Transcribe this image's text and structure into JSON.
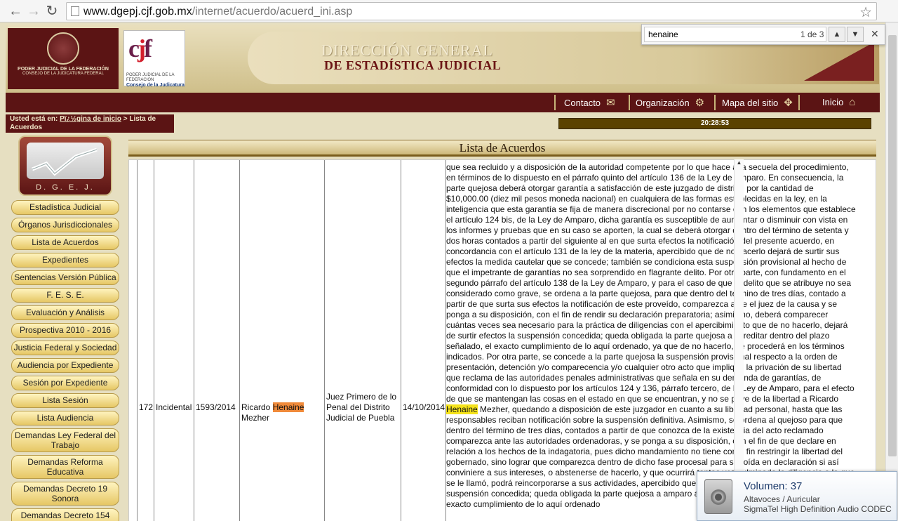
{
  "browser": {
    "url_host": "www.dgepj.cjf.gob.mx",
    "url_path": "/internet/acuerdo/acuerd_ini.asp",
    "icons": {
      "back": "back-arrow-icon",
      "forward": "forward-arrow-icon",
      "reload": "reload-icon",
      "star": "star-icon"
    }
  },
  "find": {
    "query": "henaine",
    "count": "1 de 3"
  },
  "header": {
    "seal_line1": "PODER JUDICIAL DE LA FEDERACIÓN",
    "seal_line2": "CONSEJO DE LA JUDICATURA FEDERAL",
    "cjf_sub1": "PODER JUDICIAL DE LA FEDERACIÓN",
    "cjf_sub2": "Consejo de la Judicatura",
    "title1": "DIRECCIÓN GENERAL",
    "title2": "DE ESTADÍSTICA JUDICIAL"
  },
  "nav": {
    "contacto": "Contacto",
    "organizacion": "Organización",
    "mapa": "Mapa del sitio",
    "inicio": "Inicio"
  },
  "breadcrumb": {
    "prefix": "Usted está en: ",
    "link": "Pï¿½gina de inicio",
    "suffix": " > Lista de Acuerdos"
  },
  "clock": "20:28:53",
  "sidebar": {
    "logo_label": "D. G. E. J.",
    "items": [
      "Estadística Judicial",
      "Órganos Jurisdiccionales",
      "Lista de Acuerdos",
      "Expedientes",
      "Sentencias Versión Pública",
      "F. E. S. E.",
      "Evaluación y Análisis",
      "Prospectiva 2010 - 2016",
      "Justicia Federal y Sociedad",
      "Audiencia por Expediente",
      "Sesión por Expediente",
      "Lista Sesión",
      "Lista Audiencia",
      "Demandas Ley Federal del Trabajo",
      "Demandas Reforma Educativa",
      "Demandas Decreto 19 Sonora",
      "Demandas Decreto 154"
    ]
  },
  "main": {
    "title": "Lista de Acuerdos",
    "row": {
      "num": "172",
      "tipo": "Incidental",
      "expediente": "1593/2014",
      "nombre_pre": "Ricardo ",
      "nombre_hl": "Henaine",
      "nombre_post": "Mezher",
      "juzgado": "Juez Primero de lo Penal del Distrito Judicial de Puebla",
      "fecha": "14/10/2014",
      "texto_a": "que sea recluido y a disposición de la autoridad competente por lo que hace a la secuela del procedimiento, en términos de lo dispuesto en el párrafo quinto del artículo 136 de la Ley de Amparo. En consecuencia, la parte quejosa deberá otorgar garantía a satisfacción de este juzgado de distrito, por la cantidad de $10,000.00 (diez mil pesos moneda nacional) en cualquiera de las formas establecidas en la ley, en la inteligencia que esta garantía se fija de manera discrecional por no contarse con los elementos que establece el artículo 124 bis, de la Ley de Amparo, dicha garantía es susceptible de aumentar o disminuir con vista en los informes y pruebas que en su caso se aporten, la cual se deberá otorgar dentro del término de setenta y dos horas contados a partir del siguiente al en que surta efectos la notificación del presente acuerdo, en concordancia con el artículo 131 de la ley de la materia, apercibido que de no hacerlo dejará de surtir sus efectos la medida cautelar que se concede; también se condiciona esta suspensión provisional al hecho de que el impetrante de garantías no sea sorprendido en flagrante delito. Por otra parte, con fundamento en el segundo párrafo del artículo 138 de la Ley de Amparo, y para el caso de que el delito que se atribuye no sea considerado como grave, se ordena a la parte quejosa, para que dentro del término de tres días, contado a partir de que surta sus efectos la notificación de este proveído, comparezca ante el juez de la causa y se ponga a su disposición, con el fin de rendir su declaración preparatoria; asimismo, deberá comparecer cuántas veces sea necesario para la práctica de diligencias con el apercibimiento que de no hacerlo, dejará de surtir efectos la suspensión concedida; queda obligada la parte quejosa a acreditar dentro del plazo señalado, el exacto cumplimiento de lo aquí ordenado, ya que de no hacerlo, se procederá en los términos indicados. Por otra parte, se concede a la parte quejosa la suspensión provisional respecto a la orden de presentación, detención y/o comparecencia y/o cualquier otro acto que implique la privación de su libertad que reclama de las autoridades penales administrativas que señala en su demanda de garantías, de conformidad con lo dispuesto por los artículos 124 y 136, párrafo tercero, de la Ley de Amparo, para el efecto de que se mantengan las cosas en el estado en que se encuentran, y no se prive de la libertad a Ricardo ",
      "texto_hl": "Henaine",
      "texto_b": " Mezher, quedando a disposición de este juzgador en cuanto a su libertad personal, hasta que las responsables reciban notificación sobre la suspensión definitiva. Asimismo, se ordena al quejoso para que dentro del término de tres días, contados a partir de que conozca de la existencia del acto reclamado comparezca ante las autoridades ordenadoras, y se ponga a su disposición, con el fin de que declare en relación a los hechos de la indagatoria, pues dicho mandamiento no tiene como fin restringir la libertad del gobernado, sino lograr que comparezca dentro de dicho fase procesal para ser oída en declaración si así conviniere a sus intereses, o abstenerse de hacerlo, y que ocurrirá tantas vez culminada la diligencia a la que se le llamó, podrá reincorporarse a sus actividades, apercibido que de no hacerlo, dejará de surtir efectos la suspensión concedida; queda obligada la parte quejosa a amparo a acreditar dentro del plazo señalado, el exacto cumplimiento de lo aquí ordenado"
    }
  },
  "volume": {
    "title": "Volumen: 37",
    "line1": "Altavoces / Auricular",
    "line2": "SigmaTel High Definition Audio CODEC"
  },
  "colors": {
    "maroon": "#5b1414",
    "gold": "#e6c765",
    "highlight": "#f5e31a",
    "active_highlight": "#f08a3a"
  }
}
